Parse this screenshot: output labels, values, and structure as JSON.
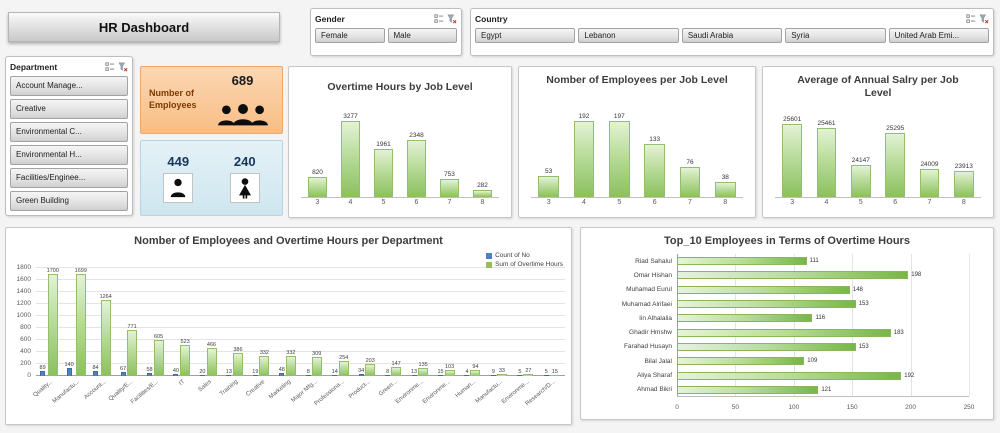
{
  "app": {
    "title": "HR Dashboard"
  },
  "slicers": {
    "gender": {
      "label": "Gender",
      "items": [
        "Female",
        "Male"
      ]
    },
    "country": {
      "label": "Country",
      "items": [
        "Egypt",
        "Lebanon",
        "Saudi Arabia",
        "Syria",
        "United Arab Emi..."
      ]
    },
    "department": {
      "label": "Department",
      "items": [
        "Account Manage...",
        "Creative",
        "Environmental C...",
        "Environmental H...",
        "Facilities/Enginee...",
        "Green Building"
      ]
    }
  },
  "kpis": {
    "employees_label": "Number of Employees",
    "total": "689",
    "male": "449",
    "female": "240"
  },
  "colors": {
    "bar_green": "#9bbb59",
    "bar_blue": "#4f81bd",
    "kpi_orange": "#fac090",
    "kpi_blue": "#daeef3"
  },
  "chart_data": [
    {
      "id": "overtime_by_level",
      "type": "bar",
      "title": "Overtime Hours by Job Level",
      "categories": [
        "3",
        "4",
        "5",
        "6",
        "7",
        "8"
      ],
      "values": [
        820,
        3277,
        1961,
        2348,
        753,
        282
      ],
      "ylim": [
        0,
        3450
      ],
      "grid": false,
      "data_labels": true
    },
    {
      "id": "employees_per_level",
      "type": "bar",
      "title": "Nomber of Employees per Job Level",
      "categories": [
        "3",
        "4",
        "5",
        "6",
        "7",
        "8"
      ],
      "values": [
        53,
        192,
        197,
        133,
        76,
        38
      ],
      "ylim": [
        0,
        210
      ],
      "grid": false,
      "data_labels": true
    },
    {
      "id": "salary_per_level",
      "type": "bar",
      "title": "Average of Annual Salry per Job Level",
      "categories": [
        "3",
        "4",
        "5",
        "6",
        "7",
        "8"
      ],
      "values": [
        25601,
        25461,
        24147,
        25295,
        24009,
        23913
      ],
      "ylim": [
        23000,
        26000
      ],
      "grid": false,
      "data_labels": true
    },
    {
      "id": "dept_combo",
      "type": "bar",
      "title": "Nomber of Employees and Overtime Hours per Department",
      "categories": [
        "Quality...",
        "Manufactu...",
        "Account...",
        "Quality/E...",
        "Facilities/E...",
        "IT",
        "Sales",
        "Training",
        "Creative",
        "Marketing",
        "Major Mfg...",
        "Professiona...",
        "Product...",
        "Green...",
        "Environme...",
        "Environme...",
        "Human...",
        "Manufactu...",
        "Environme...",
        "Research/D..."
      ],
      "series": [
        {
          "name": "Count of No",
          "color": "#4f81bd",
          "style": "blue",
          "values": [
            89,
            140,
            84,
            67,
            58,
            40,
            20,
            13,
            19,
            48,
            8,
            14,
            34,
            8,
            13,
            15,
            4,
            9,
            5,
            5
          ]
        },
        {
          "name": "Sum of Overtime Hours",
          "color": "#9bbb59",
          "style": "green",
          "values": [
            1700,
            1699,
            1264,
            771,
            605,
            523,
            466,
            386,
            332,
            332,
            309,
            254,
            203,
            147,
            135,
            103,
            94,
            33,
            27,
            15
          ]
        }
      ],
      "ylim": [
        0,
        1800
      ],
      "yticks": [
        0,
        200,
        400,
        600,
        800,
        1000,
        1200,
        1400,
        1600,
        1800
      ],
      "grid": true,
      "legend_position": "top-right",
      "data_labels": true
    },
    {
      "id": "top10",
      "type": "bar",
      "orientation": "horizontal",
      "title": "Top_10 Employees in Terms of Overtime Hours",
      "categories": [
        "Riad Sahalul",
        "Omar Hishan",
        "Muhamad Eurul",
        "Muhamad Alrifaei",
        "Iin Alhalalia",
        "Ghadir Hmshw",
        "Farahad Husayn",
        "Bilal Jalal",
        "Aliya Sharaf",
        "Ahmad Bikri"
      ],
      "values": [
        111,
        198,
        148,
        153,
        116,
        183,
        153,
        109,
        192,
        121
      ],
      "xlim": [
        0,
        250
      ],
      "xticks": [
        0,
        50,
        100,
        150,
        200,
        250
      ],
      "grid": true,
      "data_labels": true
    }
  ]
}
